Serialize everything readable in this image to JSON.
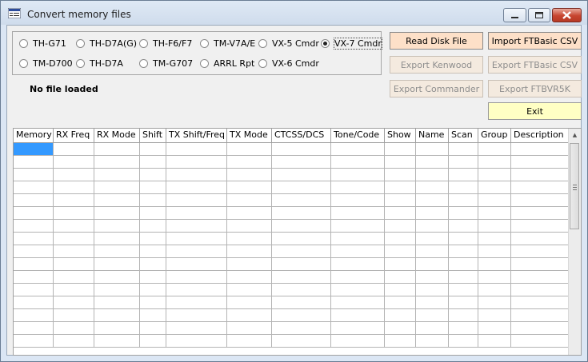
{
  "window": {
    "title": "Convert memory files"
  },
  "radios": [
    {
      "label": "TH-G71",
      "checked": false
    },
    {
      "label": "TH-D7A(G)",
      "checked": false
    },
    {
      "label": "TH-F6/F7",
      "checked": false
    },
    {
      "label": "TM-V7A/E",
      "checked": false
    },
    {
      "label": "VX-5 Cmdr",
      "checked": false
    },
    {
      "label": "VX-7 Cmdr",
      "checked": true
    },
    {
      "label": "TM-D700",
      "checked": false
    },
    {
      "label": "TH-D7A",
      "checked": false
    },
    {
      "label": "TM-G707",
      "checked": false
    },
    {
      "label": "ARRL Rpt",
      "checked": false
    },
    {
      "label": "VX-6 Cmdr",
      "checked": false
    }
  ],
  "buttons": {
    "read_disk": "Read Disk File",
    "import_ftbasic": "Import FTBasic CSV",
    "export_kenwood": "Export Kenwood",
    "export_ftbasic": "Export FTBasic CSV",
    "export_commander": "Export Commander",
    "export_ftbvr5k": "Export FTBVR5K",
    "exit": "Exit"
  },
  "status": "No file loaded",
  "grid": {
    "columns": [
      "Memory",
      "RX Freq",
      "RX Mode",
      "Shift",
      "TX Shift/Freq",
      "TX Mode",
      "CTCSS/DCS",
      "Tone/Code",
      "Show",
      "Name",
      "Scan",
      "Group",
      "Description"
    ],
    "empty_rows": 16
  }
}
